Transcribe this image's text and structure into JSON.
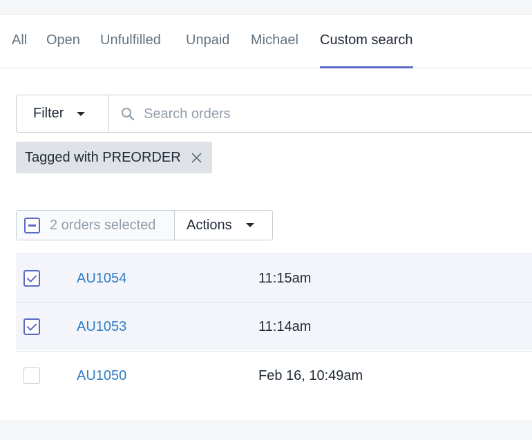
{
  "tabs": [
    {
      "label": "All"
    },
    {
      "label": "Open"
    },
    {
      "label": "Unfulfilled"
    },
    {
      "label": "Unpaid"
    },
    {
      "label": "Michael"
    },
    {
      "label": "Custom search"
    }
  ],
  "active_tab": "Custom search",
  "filter": {
    "button_label": "Filter",
    "search_placeholder": "Search orders",
    "search_value": ""
  },
  "applied_tag": {
    "label": "Tagged with PREORDER"
  },
  "bulk": {
    "selected_label": "2 orders selected",
    "actions_label": "Actions"
  },
  "orders": [
    {
      "id": "AU1054",
      "date": "11:15am",
      "checked": true
    },
    {
      "id": "AU1053",
      "date": "11:14am",
      "checked": true
    },
    {
      "id": "AU1050",
      "date": "Feb 16, 10:49am",
      "checked": false
    }
  ],
  "colors": {
    "accent": "#5c6ac4",
    "link": "#2e7dc6",
    "selected_row": "#f4f5fa"
  },
  "icons": {
    "filter": "caret-down-icon",
    "search": "search-icon",
    "tag_remove": "close-icon"
  }
}
